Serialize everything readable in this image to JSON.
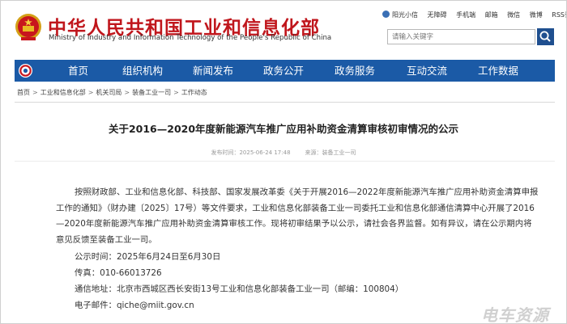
{
  "site": {
    "title": "中华人民共和国工业和信息化部",
    "subtitle": "Ministry of Industry and Information Technology of the People's Republic of China"
  },
  "toplinks": [
    "阳光小信",
    "无障碍",
    "手机端",
    "邮箱",
    "微信",
    "微博",
    "RSS订阅"
  ],
  "search": {
    "placeholder": "请输入关键字"
  },
  "nav": [
    "首页",
    "组织机构",
    "新闻发布",
    "政务公开",
    "政务服务",
    "互动交流",
    "工作数据"
  ],
  "breadcrumb": [
    "首页",
    "工业和信息化部",
    "机关司局",
    "装备工业一司",
    "工作动态"
  ],
  "breadcrumb_sep": ">",
  "article": {
    "title": "关于2016—2020年度新能源汽车推广应用补助资金清算审核初审情况的公示",
    "publish_time": "发布时间：2025-06-24 17:48",
    "source": "来源：装备工业一司",
    "paragraph": "按照财政部、工业和信息化部、科技部、国家发展改革委《关于开展2016—2022年度新能源汽车推广应用补助资金清算申报工作的通知》（财办建〔2025〕17号）等文件要求，工业和信息化部装备工业一司委托工业和信息化部通信清算中心开展了2016—2020年度新能源汽车推广应用补助资金清算审核工作。现将初审结果予以公示，请社会各界监督。如有异议，请在公示期内将意见反馈至装备工业一司。",
    "notice_period": "公示时间：2025年6月24日至6月30日",
    "fax": "传真：010-66013726",
    "address": "通信地址：北京市西城区西长安街13号工业和信息化部装备工业一司（邮编：100804）",
    "email": "电子邮件：qiche@miit.gov.cn"
  },
  "watermark": "电车资源",
  "colors": {
    "brand_red": "#c0161c",
    "nav_blue": "#1b5aa6",
    "search_btn": "#1f4f8f"
  },
  "icons": {
    "emblem": "national-emblem-icon",
    "search": "search-icon",
    "nav_logo": "miit-logo-icon",
    "toplink": "user-icon"
  }
}
